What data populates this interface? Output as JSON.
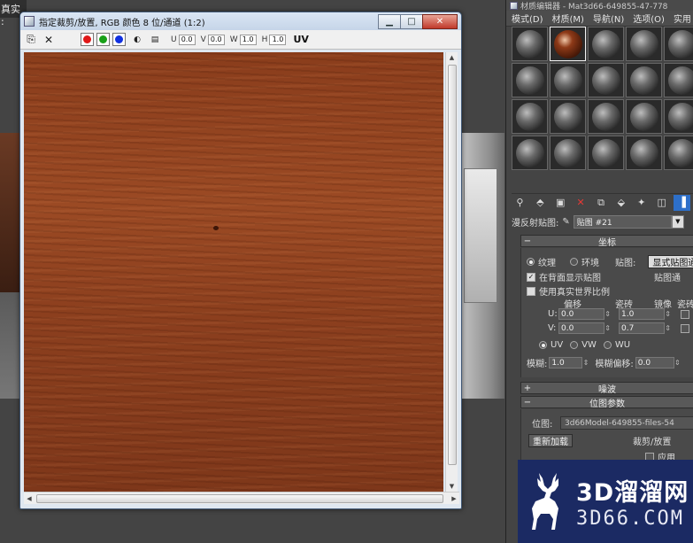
{
  "viewport": {
    "label": "真实 :"
  },
  "frame_buffer": {
    "title": "指定裁剪/放置, RGB 颜色 8 位/通道 (1:2)",
    "window_buttons": {
      "minimize": "▁",
      "maximize": "□",
      "close": "✕"
    },
    "toolbar": {
      "u_label": "U",
      "u_value": "0.0",
      "v_label": "V",
      "v_value": "0.0",
      "w_label": "W",
      "w_value": "1.0",
      "h_label": "H",
      "h_value": "1.0",
      "uv_label": "UV"
    },
    "channel_colors": {
      "red": "#e01818",
      "green": "#18a018",
      "blue": "#1030e0"
    }
  },
  "material_editor": {
    "title": "材质编辑器 - Mat3d66-649855-47-778",
    "menu": [
      "模式(D)",
      "材质(M)",
      "导航(N)",
      "选项(O)",
      "实用"
    ],
    "active_slot": 1,
    "map_row": {
      "label": "漫反射贴图:",
      "value": "贴图 #21"
    },
    "coordinates": {
      "header": "坐标",
      "texture_label": "纹理",
      "environ_label": "环境",
      "mapping_label": "贴图:",
      "mapping_value": "显式贴图通",
      "map_channel": "贴图通",
      "show_back": "在背面显示贴图",
      "real_world": "使用真实世界比例",
      "offset_label": "偏移",
      "tiling_label": "瓷砖",
      "mirror_label": "镜像",
      "tile_col_label": "瓷砖",
      "u_label": "U:",
      "u_offset": "0.0",
      "u_tiling": "1.0",
      "v_label": "V:",
      "v_offset": "0.0",
      "v_tiling": "0.7",
      "uv": "UV",
      "vw": "VW",
      "wu": "WU",
      "blur_label": "模糊:",
      "blur_value": "1.0",
      "blur_offset_label": "模糊偏移:",
      "blur_offset_value": "0.0"
    },
    "noise": {
      "header": "噪波"
    },
    "bitmap_params": {
      "header": "位图参数",
      "bitmap_label": "位图:",
      "bitmap_path": "3d66Model-649855-files-54",
      "reload": "重新加载",
      "crop_label": "裁剪/放置",
      "apply": "应用"
    }
  },
  "watermark": {
    "top": "3D溜溜网",
    "bottom": "3D66.COM"
  }
}
